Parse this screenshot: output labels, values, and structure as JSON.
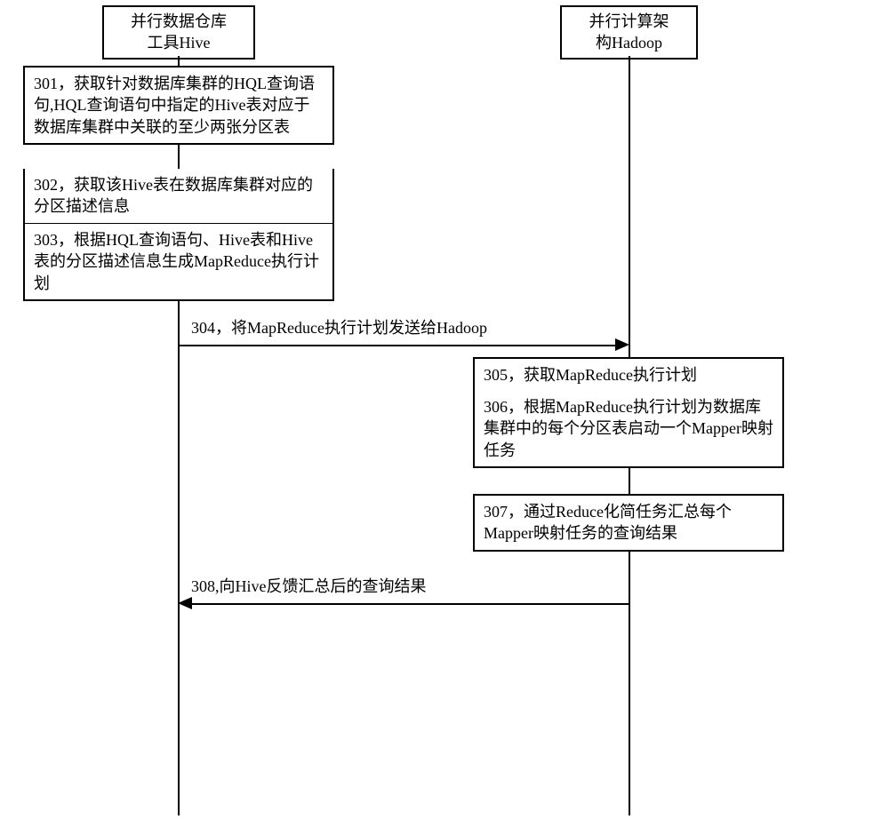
{
  "headers": {
    "hive": {
      "line1": "并行数据仓库",
      "line2": "工具Hive"
    },
    "hadoop": {
      "line1": "并行计算架",
      "line2": "构Hadoop"
    }
  },
  "steps": {
    "s301": "301，获取针对数据库集群的HQL查询语句,HQL查询语句中指定的Hive表对应于数据库集群中关联的至少两张分区表",
    "s302": "302，获取该Hive表在数据库集群对应的分区描述信息",
    "s303": "303，根据HQL查询语句、Hive表和Hive表的分区描述信息生成MapReduce执行计划",
    "s304": "304，将MapReduce执行计划发送给Hadoop",
    "s305": "305，获取MapReduce执行计划",
    "s306": "306，根据MapReduce执行计划为数据库集群中的每个分区表启动一个Mapper映射任务",
    "s307": "307，通过Reduce化简任务汇总每个Mapper映射任务的查询结果",
    "s308": "308,向Hive反馈汇总后的查询结果"
  }
}
